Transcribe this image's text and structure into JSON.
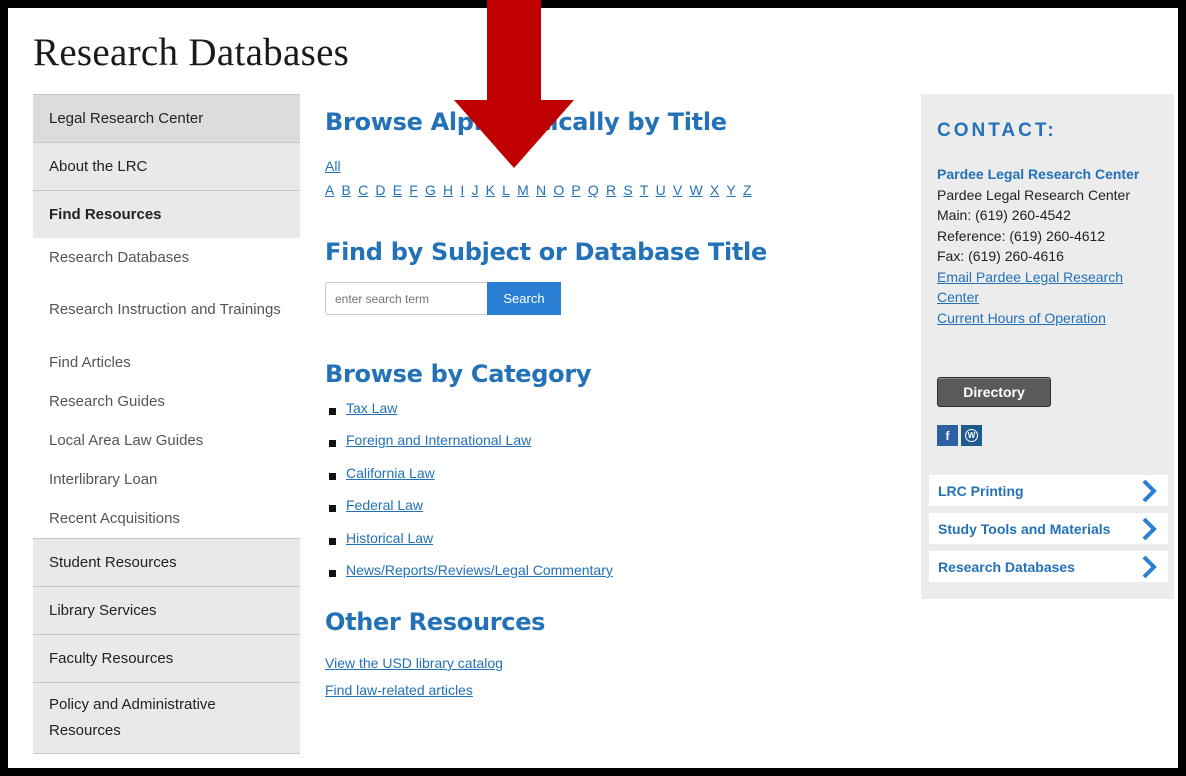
{
  "page": {
    "title": "Research Databases"
  },
  "sidebar": {
    "items": [
      {
        "label": "Legal Research Center",
        "kind": "main"
      },
      {
        "label": "About the LRC",
        "kind": "main"
      },
      {
        "label": "Find Resources",
        "kind": "main"
      },
      {
        "label": "Research Databases",
        "kind": "sub"
      },
      {
        "label": "Research Instruction and Trainings",
        "kind": "sub"
      },
      {
        "label": "Find Articles",
        "kind": "sub"
      },
      {
        "label": "Research Guides",
        "kind": "sub"
      },
      {
        "label": "Local Area Law Guides",
        "kind": "sub"
      },
      {
        "label": "Interlibrary Loan",
        "kind": "sub"
      },
      {
        "label": "Recent Acquisitions",
        "kind": "sub"
      },
      {
        "label": "Student Resources",
        "kind": "main"
      },
      {
        "label": "Library Services",
        "kind": "main"
      },
      {
        "label": "Faculty Resources",
        "kind": "main"
      },
      {
        "label": "Policy and Administrative Resources",
        "kind": "main"
      }
    ]
  },
  "main": {
    "browse_alpha": {
      "heading": "Browse Alphabetically by Title",
      "all_label": "All",
      "letters": [
        "A",
        "B",
        "C",
        "D",
        "E",
        "F",
        "G",
        "H",
        "I",
        "J",
        "K",
        "L",
        "M",
        "N",
        "O",
        "P",
        "Q",
        "R",
        "S",
        "T",
        "U",
        "V",
        "W",
        "X",
        "Y",
        "Z"
      ]
    },
    "find": {
      "heading": "Find by Subject or Database Title",
      "placeholder": "enter search term",
      "button": "Search"
    },
    "categories": {
      "heading": "Browse by Category",
      "items": [
        "Tax Law",
        "Foreign and International Law",
        "California Law",
        "Federal Law",
        "Historical Law",
        "News/Reports/Reviews/Legal Commentary"
      ]
    },
    "other": {
      "heading": "Other Resources",
      "links": [
        "View the USD library catalog",
        "Find law-related articles"
      ]
    }
  },
  "contact": {
    "title": "CONTACT:",
    "org_link": "Pardee Legal Research Center",
    "org_name": "Pardee Legal Research Center",
    "main_phone": "Main: (619) 260-4542",
    "reference_phone": "Reference: (619) 260-4612",
    "fax": "Fax: (619) 260-4616",
    "email_link": "Email Pardee Legal Research Center",
    "hours_link": "Current Hours of Operation",
    "directory_button": "Directory",
    "social": [
      {
        "icon": "facebook-icon",
        "glyph": "f"
      },
      {
        "icon": "wordpress-icon",
        "glyph": "W"
      }
    ],
    "quick_links": [
      "LRC Printing",
      "Study Tools and Materials",
      "Research Databases"
    ]
  },
  "colors": {
    "link_blue": "#2372b8",
    "arrow_red": "#c00000",
    "search_button": "#2a7fd4"
  }
}
